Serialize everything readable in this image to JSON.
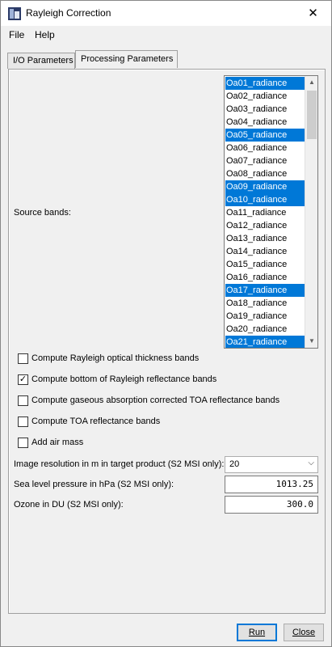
{
  "window": {
    "title": "Rayleigh Correction",
    "close_label": "✕"
  },
  "menu": {
    "file": "File",
    "help": "Help"
  },
  "tabs": [
    {
      "label": "I/O Parameters"
    },
    {
      "label": "Processing Parameters"
    }
  ],
  "source_bands": {
    "label": "Source bands:",
    "items": [
      {
        "label": "Oa01_radiance",
        "selected": true
      },
      {
        "label": "Oa02_radiance",
        "selected": false
      },
      {
        "label": "Oa03_radiance",
        "selected": false
      },
      {
        "label": "Oa04_radiance",
        "selected": false
      },
      {
        "label": "Oa05_radiance",
        "selected": true
      },
      {
        "label": "Oa06_radiance",
        "selected": false
      },
      {
        "label": "Oa07_radiance",
        "selected": false
      },
      {
        "label": "Oa08_radiance",
        "selected": false
      },
      {
        "label": "Oa09_radiance",
        "selected": true
      },
      {
        "label": "Oa10_radiance",
        "selected": true
      },
      {
        "label": "Oa11_radiance",
        "selected": false
      },
      {
        "label": "Oa12_radiance",
        "selected": false
      },
      {
        "label": "Oa13_radiance",
        "selected": false
      },
      {
        "label": "Oa14_radiance",
        "selected": false
      },
      {
        "label": "Oa15_radiance",
        "selected": false
      },
      {
        "label": "Oa16_radiance",
        "selected": false
      },
      {
        "label": "Oa17_radiance",
        "selected": true
      },
      {
        "label": "Oa18_radiance",
        "selected": false
      },
      {
        "label": "Oa19_radiance",
        "selected": false
      },
      {
        "label": "Oa20_radiance",
        "selected": false
      },
      {
        "label": "Oa21_radiance",
        "selected": true
      }
    ]
  },
  "checkboxes": [
    {
      "label": "Compute Rayleigh optical thickness bands",
      "checked": false
    },
    {
      "label": "Compute bottom of Rayleigh reflectance bands",
      "checked": true
    },
    {
      "label": "Compute gaseous absorption corrected TOA reflectance bands",
      "checked": false
    },
    {
      "label": "Compute TOA reflectance bands",
      "checked": false
    },
    {
      "label": "Add air mass",
      "checked": false
    }
  ],
  "fields": {
    "resolution_label": "Image resolution in m in target product (S2 MSI only):",
    "resolution_value": "20",
    "pressure_label": "Sea level pressure in hPa (S2 MSI only):",
    "pressure_value": "1013.25",
    "ozone_label": "Ozone in DU (S2 MSI only):",
    "ozone_value": "300.0"
  },
  "buttons": {
    "run": "Run",
    "close": "Close"
  },
  "colors": {
    "selection": "#0078d7",
    "accent": "#0078d7"
  }
}
